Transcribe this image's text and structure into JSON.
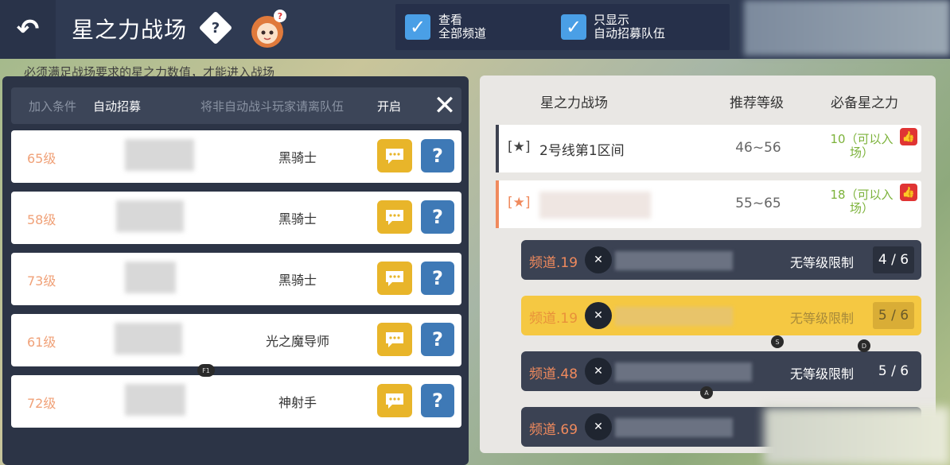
{
  "topbar": {
    "back_icon": "↶",
    "title": "星之力战场",
    "help_icon": "◆?",
    "filters": [
      {
        "checked": true,
        "label_line1": "查看",
        "label_line2": "全部频道"
      },
      {
        "checked": true,
        "label_line1": "只显示",
        "label_line2": "自动招募队伍"
      }
    ]
  },
  "notice": "必须满足战场要求的星之力数值，才能进入战场",
  "recruit_bar": {
    "condition_label": "加入条件",
    "condition_value": "自动招募",
    "kick_label": "将非自动战斗玩家请离队伍",
    "kick_value": "开启",
    "close_icon": "✕"
  },
  "players": [
    {
      "level": "65级",
      "class": "黑骑士"
    },
    {
      "level": "58级",
      "class": "黑骑士"
    },
    {
      "level": "73级",
      "class": "黑骑士"
    },
    {
      "level": "61级",
      "class": "光之魔导师"
    },
    {
      "level": "72级",
      "class": "神射手"
    }
  ],
  "player_buttons": {
    "help": "?"
  },
  "markers": {
    "f1": "F1",
    "s": "S",
    "d": "D",
    "a": "A"
  },
  "battlefield_table": {
    "headers": {
      "name": "星之力战场",
      "level": "推荐等级",
      "power": "必备星之力"
    },
    "rows": [
      {
        "star": "[★]",
        "name": "2号线第1区间",
        "level": "46~56",
        "power_line1": "10（可以入",
        "power_line2": "场）",
        "bar_color": "#3d4250",
        "star_color": "#444444"
      },
      {
        "star": "[★]",
        "name": "",
        "level": "55~65",
        "power_line1": "18（可以入",
        "power_line2": "场）",
        "bar_color": "#f08a5d",
        "star_color": "#f08a5d"
      }
    ]
  },
  "channels": [
    {
      "label": "频道.19",
      "limit": "无等级限制",
      "count": "4 / 6",
      "highlighted": false
    },
    {
      "label": "频道.19",
      "limit": "无等级限制",
      "count": "5 / 6",
      "highlighted": true
    },
    {
      "label": "频道.48",
      "limit": "无等级限制",
      "count": "5 / 6",
      "highlighted": false
    },
    {
      "label": "频道.69",
      "limit": "",
      "count": "",
      "highlighted": false
    }
  ],
  "colors": {
    "topbar": "#2f3a52",
    "accent_orange": "#f08a5d",
    "highlight_yellow": "#f5c842",
    "power_green": "#7cb23a",
    "checkbox_blue": "#4a9fe6"
  }
}
